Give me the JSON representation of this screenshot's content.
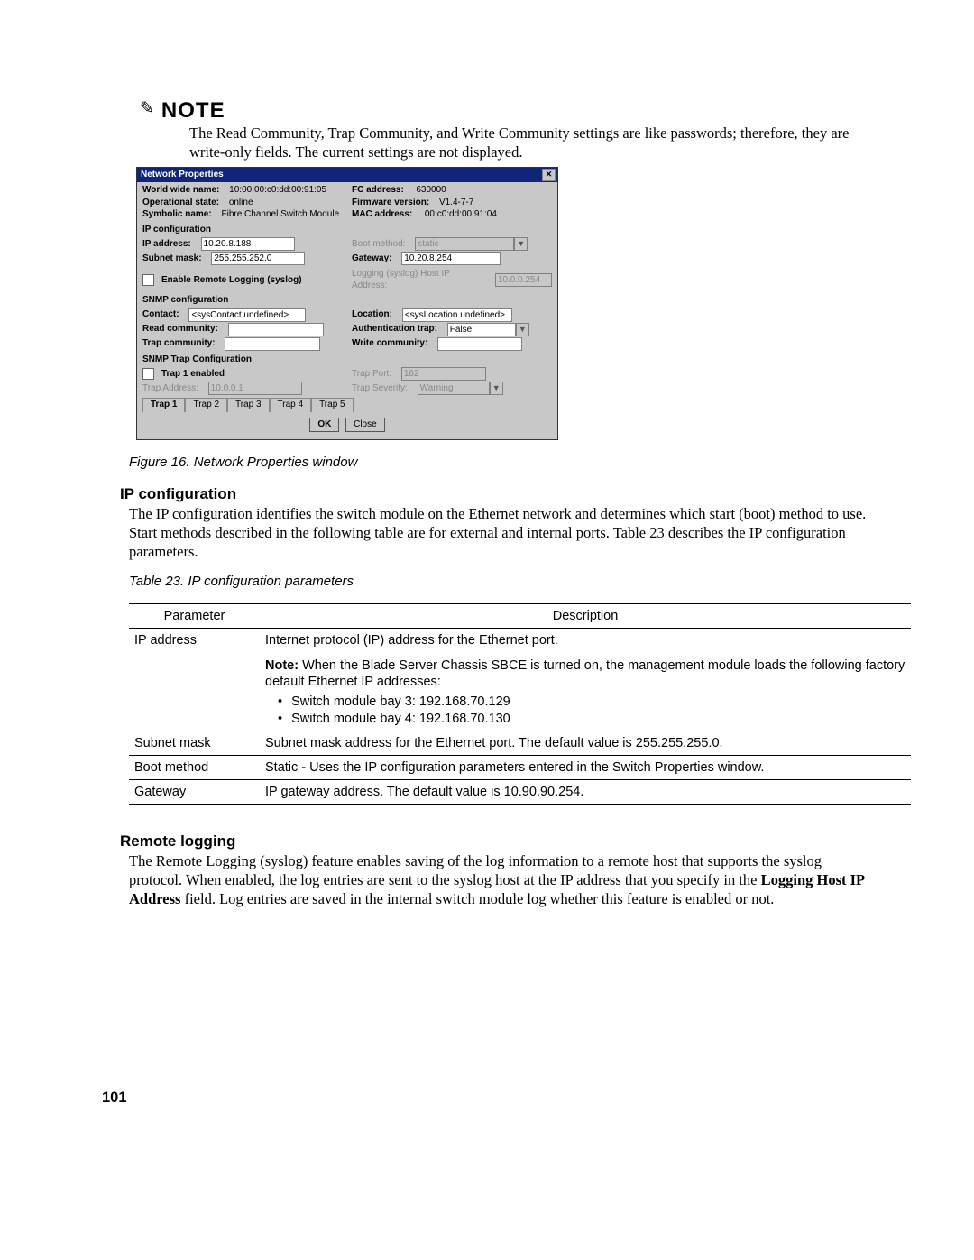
{
  "note": {
    "icon": "✎",
    "title": "NOTE",
    "text": "The Read Community, Trap Community, and Write Community settings are like passwords; therefore, they are write-only fields. The current settings are not displayed."
  },
  "dialog": {
    "title": "Network Properties",
    "wwn_label": "World wide name:",
    "wwn": "10:00:00:c0:dd:00:91:05",
    "fcaddr_label": "FC address:",
    "fcaddr": "630000",
    "op_label": "Operational state:",
    "op": "online",
    "fw_label": "Firmware version:",
    "fw": "V1.4-7-7",
    "sym_label": "Symbolic name:",
    "sym": "Fibre Channel Switch Module",
    "mac_label": "MAC address:",
    "mac": "00:c0:dd:00:91:04",
    "ip_section": "IP configuration",
    "ipaddr_label": "IP address:",
    "ipaddr": "10.20.8.188",
    "boot_label": "Boot method:",
    "boot": "static",
    "subnet_label": "Subnet mask:",
    "subnet": "255.255.252.0",
    "gateway_label": "Gateway:",
    "gateway": "10.20.8.254",
    "remote_log_chk": "Enable Remote Logging (syslog)",
    "loghost_label": "Logging (syslog) Host IP Address:",
    "loghost": "10.0.0.254",
    "snmp_section": "SNMP configuration",
    "contact_label": "Contact:",
    "contact": "<sysContact undefined>",
    "location_label": "Location:",
    "location": "<sysLocation undefined>",
    "read_label": "Read community:",
    "auth_label": "Authentication trap:",
    "auth": "False",
    "trapc_label": "Trap community:",
    "writec_label": "Write community:",
    "snmptrap_section": "SNMP Trap Configuration",
    "trap1_chk": "Trap 1 enabled",
    "trapport_label": "Trap Port:",
    "trapport": "162",
    "trapaddr_label": "Trap Address:",
    "trapaddr": "10.0.0.1",
    "trapsev_label": "Trap Severity:",
    "trapsev": "Warning",
    "tabs": [
      "Trap 1",
      "Trap 2",
      "Trap 3",
      "Trap 4",
      "Trap 5"
    ],
    "ok": "OK",
    "close": "Close"
  },
  "fig_caption": "Figure 16. Network Properties window",
  "ip_heading": "IP configuration",
  "ip_para": "The IP configuration identifies the switch module on the Ethernet network and determines which start (boot) method to use. Start methods described in the following table are for external and internal ports. Table 23 describes the IP configuration parameters.",
  "table_caption": "Table 23. IP configuration parameters",
  "table": {
    "h1": "Parameter",
    "h2": "Description",
    "rows": [
      {
        "param": "IP address",
        "desc1": "Internet protocol (IP) address for the Ethernet port.",
        "note_prefix": "Note:",
        "note_text": " When the Blade Server Chassis SBCE is turned on, the management module loads the following factory default Ethernet IP addresses:",
        "bullets": [
          "Switch module bay 3: 192.168.70.129",
          "Switch module bay 4: 192.168.70.130"
        ]
      },
      {
        "param": "Subnet mask",
        "desc": "Subnet mask address for the Ethernet port. The default value is 255.255.255.0."
      },
      {
        "param": "Boot method",
        "desc": "Static - Uses the IP configuration parameters entered in the Switch Properties window."
      },
      {
        "param": "Gateway",
        "desc": "IP gateway address. The default value is 10.90.90.254."
      }
    ]
  },
  "remote_heading": "Remote logging",
  "remote_para1": "The Remote Logging (syslog) feature enables saving of the log information to a remote host that supports the syslog protocol. When enabled, the log entries are sent to the syslog host at the IP address that you specify in the ",
  "remote_bold": "Logging Host IP Address",
  "remote_para2": " field. Log entries are saved in the internal switch module log whether this feature is enabled or not.",
  "page_number": "101"
}
